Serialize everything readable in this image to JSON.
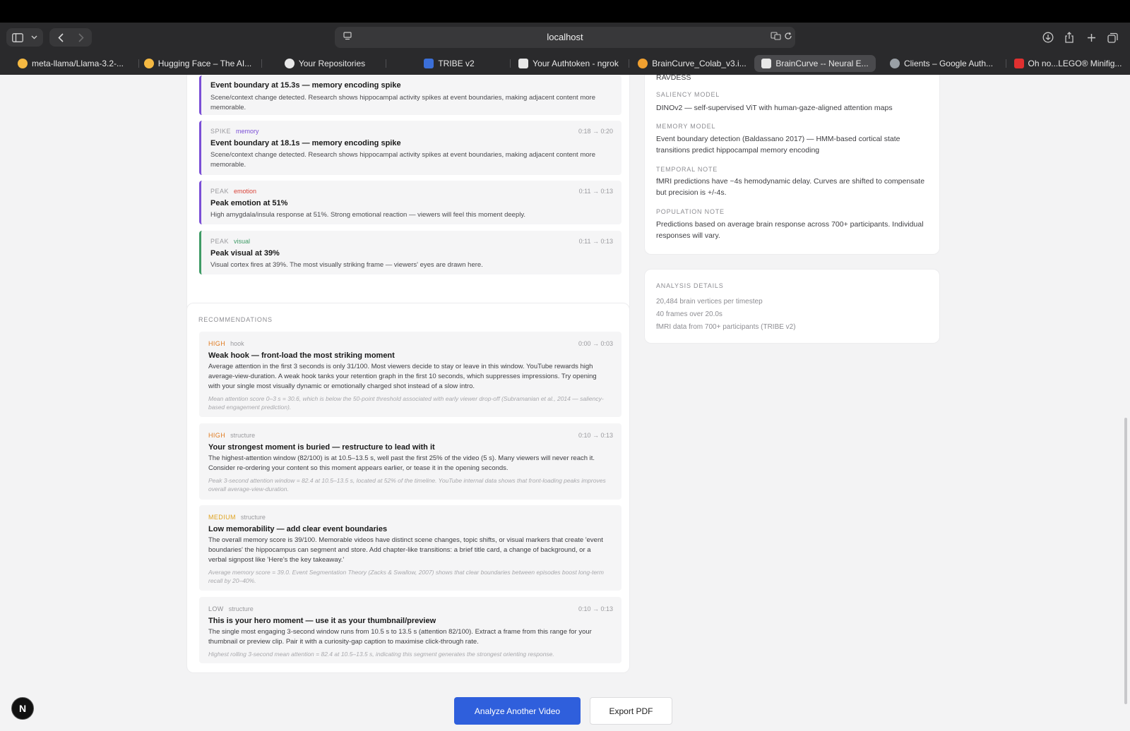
{
  "browser": {
    "url": "localhost",
    "tabs": [
      {
        "label": "meta-llama/Llama-3.2-...",
        "fav_color": "#f5b942"
      },
      {
        "label": "Hugging Face – The AI...",
        "fav_color": "#f5b942"
      },
      {
        "label": "Your Repositories",
        "fav_color": "#e8e8e8"
      },
      {
        "label": "TRIBE v2",
        "fav_color": "#3b6fd8"
      },
      {
        "label": "Your Authtoken - ngrok",
        "fav_color": "#e8e8e8"
      },
      {
        "label": "BrainCurve_Colab_v3.i...",
        "fav_color": "#f0a030"
      },
      {
        "label": "BrainCurve -- Neural E...",
        "fav_color": "#e8e8e8"
      },
      {
        "label": "Clients – Google Auth...",
        "fav_color": "#9aa0a6"
      },
      {
        "label": "Oh no...LEGO® Minifig...",
        "fav_color": "#e03030"
      }
    ]
  },
  "moments": [
    {
      "type": "",
      "tag": "",
      "time": "",
      "title": "Event boundary at 15.3s — memory encoding spike",
      "desc": "Scene/context change detected. Research shows hippocampal activity spikes at event boundaries, making adjacent content more memorable."
    },
    {
      "type": "SPIKE",
      "tag": "memory",
      "tag_color": "#7b4fd6",
      "time": "0:18 → 0:20",
      "title": "Event boundary at 18.1s — memory encoding spike",
      "desc": "Scene/context change detected. Research shows hippocampal activity spikes at event boundaries, making adjacent content more memorable."
    },
    {
      "type": "PEAK",
      "tag": "emotion",
      "tag_color": "#d9443a",
      "time": "0:11 → 0:13",
      "title": "Peak emotion at 51%",
      "desc": "High amygdala/insula response at 51%. Strong emotional reaction — viewers will feel this moment deeply."
    },
    {
      "type": "PEAK",
      "tag": "visual",
      "tag_color": "#3f9b66",
      "time": "0:11 → 0:13",
      "title": "Peak visual at 39%",
      "desc": "Visual cortex fires at 39%. The most visually striking frame — viewers' eyes are drawn here."
    }
  ],
  "recommendations": {
    "label": "RECOMMENDATIONS",
    "items": [
      {
        "priority": "HIGH",
        "category": "hook",
        "time": "0:00 → 0:03",
        "title": "Weak hook — front-load the most striking moment",
        "desc": "Average attention in the first 3 seconds is only 31/100. Most viewers decide to stay or leave in this window. YouTube rewards high average-view-duration. A weak hook tanks your retention graph in the first 10 seconds, which suppresses impressions. Try opening with your single most visually dynamic or emotionally charged shot instead of a slow intro.",
        "ref": "Mean attention score 0–3 s = 30.6, which is below the 50-point threshold associated with early viewer drop-off (Subramanian et al., 2014 — saliency-based engagement prediction)."
      },
      {
        "priority": "HIGH",
        "category": "structure",
        "time": "0:10 → 0:13",
        "title": "Your strongest moment is buried — restructure to lead with it",
        "desc": "The highest-attention window (82/100) is at 10.5–13.5 s, well past the first 25% of the video (5 s). Many viewers will never reach it. Consider re-ordering your content so this moment appears earlier, or tease it in the opening seconds.",
        "ref": "Peak 3-second attention window = 82.4 at 10.5–13.5 s, located at 52% of the timeline. YouTube internal data shows that front-loading peaks improves overall average-view-duration."
      },
      {
        "priority": "MEDIUM",
        "category": "structure",
        "time": "",
        "title": "Low memorability — add clear event boundaries",
        "desc": "The overall memory score is 39/100. Memorable videos have distinct scene changes, topic shifts, or visual markers that create 'event boundaries' the hippocampus can segment and store. Add chapter-like transitions: a brief title card, a change of background, or a verbal signpost like 'Here's the key takeaway.'",
        "ref": "Average memory score = 39.0. Event Segmentation Theory (Zacks & Swallow, 2007) shows that clear boundaries between episodes boost long-term recall by 20–40%."
      },
      {
        "priority": "LOW",
        "category": "structure",
        "time": "0:10 → 0:13",
        "title": "This is your hero moment — use it as your thumbnail/preview",
        "desc": "The single most engaging 3-second window runs from 10.5 s to 13.5 s (attention 82/100). Extract a frame from this range for your thumbnail or preview clip. Pair it with a curiosity-gap caption to maximise click-through rate.",
        "ref": "Highest rolling 3-second mean attention = 82.4 at 10.5–13.5 s, indicating this segment generates the strongest orienting response."
      }
    ]
  },
  "models": {
    "top_text": "RAVDESS",
    "items": [
      {
        "label": "SALIENCY MODEL",
        "value": "DINOv2 — self-supervised ViT with human-gaze-aligned attention maps"
      },
      {
        "label": "MEMORY MODEL",
        "value": "Event boundary detection (Baldassano 2017) — HMM-based cortical state transitions predict hippocampal memory encoding"
      },
      {
        "label": "TEMPORAL NOTE",
        "value": "fMRI predictions have ~4s hemodynamic delay. Curves are shifted to compensate but precision is +/-4s."
      },
      {
        "label": "POPULATION NOTE",
        "value": "Predictions based on average brain response across 700+ participants. Individual responses will vary."
      }
    ]
  },
  "analysis": {
    "label": "ANALYSIS DETAILS",
    "lines": [
      "20,484 brain vertices per timestep",
      "40 frames over 20.0s",
      "fMRI data from 700+ participants (TRIBE v2)"
    ]
  },
  "actions": {
    "analyze": "Analyze Another Video",
    "export": "Export PDF"
  },
  "badge": "N"
}
